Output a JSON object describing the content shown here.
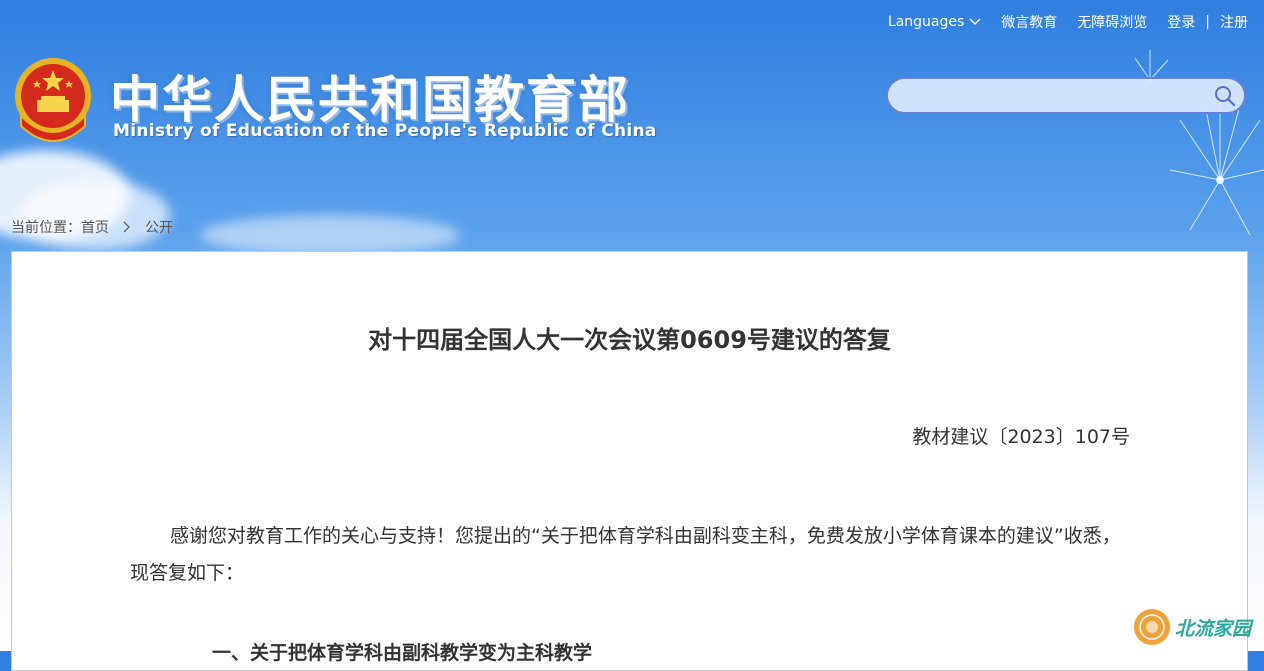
{
  "header": {
    "title_cn": "中华人民共和国教育部",
    "title_en": "Ministry of Education of the People's Republic of China",
    "top_links": {
      "languages": "Languages",
      "weiyan": "微言教育",
      "accessibility": "无障碍浏览",
      "login": "登录",
      "separator": "|",
      "register": "注册"
    },
    "search": {
      "placeholder": "",
      "value": ""
    }
  },
  "breadcrumb": {
    "prefix": "当前位置：",
    "home": "首页",
    "current": "公开"
  },
  "document": {
    "title": "对十四届全国人大一次会议第0609号建议的答复",
    "number": "教材建议〔2023〕107号",
    "paragraph_1": "感谢您对教育工作的关心与支持！您提出的“关于把体育学科由副科变主科，免费发放小学体育课本的建议”收悉，现答复如下：",
    "subheading_1": "一、关于把体育学科由副科教学变为主科教学"
  },
  "watermark": {
    "text": "北流家园"
  },
  "colors": {
    "sky_top": "#2f7fe0",
    "search_border": "#6a7fd6",
    "text": "#333333",
    "watermark": "#2aa8a0"
  },
  "icons": [
    "national-emblem-icon",
    "chevron-down-icon",
    "search-icon",
    "chevron-right-icon",
    "watermark-seal-icon"
  ]
}
